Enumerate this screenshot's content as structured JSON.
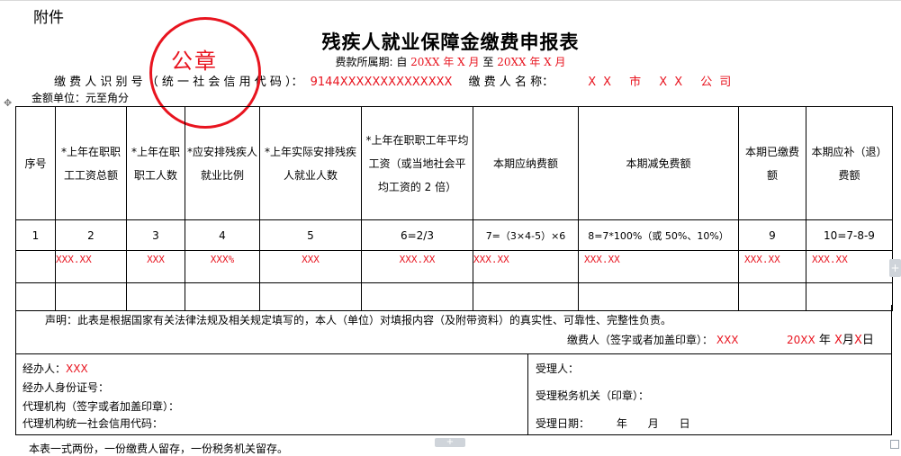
{
  "header": {
    "attachment": "附件",
    "title": "残疾人就业保障金缴费申报表",
    "period_label": "费款所属期:",
    "period_from_prefix": "自",
    "period_from_value": "20XX 年 X 月",
    "period_to_prefix": "至",
    "period_to_value": "20XX 年 X 月",
    "taxid_label": "缴 费 人 识 别 号 （ 统 一 社 会 信 用 代 码 ）：",
    "taxid_value": "9144XXXXXXXXXXXXXX",
    "payer_name_label": "缴 费 人 名 称：",
    "payer_name_value": "XX 市 XX 公司",
    "unit": "金额单位：元至角分"
  },
  "seal": {
    "text": "公章",
    "color": "#e8141f"
  },
  "table": {
    "headers": [
      "序号",
      "*上年在职职工工资总额",
      "*上年在职职工人数",
      "*应安排残疾人就业比例",
      "*上年实际安排残疾人就业人数",
      "*上年在职职工年平均工资（或当地社会平均工资的 2 倍）",
      "本期应纳费额",
      "本期减免费额",
      "本期已缴费额",
      "本期应补（退）费额"
    ],
    "numbers": [
      "1",
      "2",
      "3",
      "4",
      "5",
      "6=2/3",
      "7=（3×4-5）×6",
      "8=7*100%（或 50%、10%）",
      "9",
      "10=7-8-9"
    ],
    "values": [
      "",
      "XXX.XX",
      "XXX",
      "XXX%",
      "XXX",
      "XXX.XX",
      "XXX.XX",
      "XXX.XX",
      "XXX.XX",
      "XXX.XX"
    ]
  },
  "declaration": {
    "text": "声明：此表是根据国家有关法律法规及相关规定填写的，本人（单位）对填报内容（及附带资料）的真实性、可靠性、完整性负责。",
    "payer_sign_label": "缴费人（签字或者加盖印章）：",
    "payer_sign_value": "XXX",
    "date_year": "20XX",
    "date_year_unit": "年",
    "date_month": "X",
    "date_month_unit": "月",
    "date_day": "X",
    "date_day_unit": "日"
  },
  "bottom": {
    "handler_label": "经办人：",
    "handler_value": "XXX",
    "handler_id_label": "经办人身份证号：",
    "agency_label": "代理机构（签字或者加盖印章）：",
    "agency_credit_label": "代理机构统一社会信用代码：",
    "receiver_label": "受理人：",
    "tax_authority_label": "受理税务机关（印章）：",
    "receive_date_label": "受理日期：",
    "receive_date_units": "年      月      日"
  },
  "footer": "本表一式两份，一份缴费人留存，一份税务机关留存。",
  "editor": {
    "move_icon": "✥",
    "plus": "+"
  },
  "colors": {
    "accent_red": "#e8141f"
  }
}
